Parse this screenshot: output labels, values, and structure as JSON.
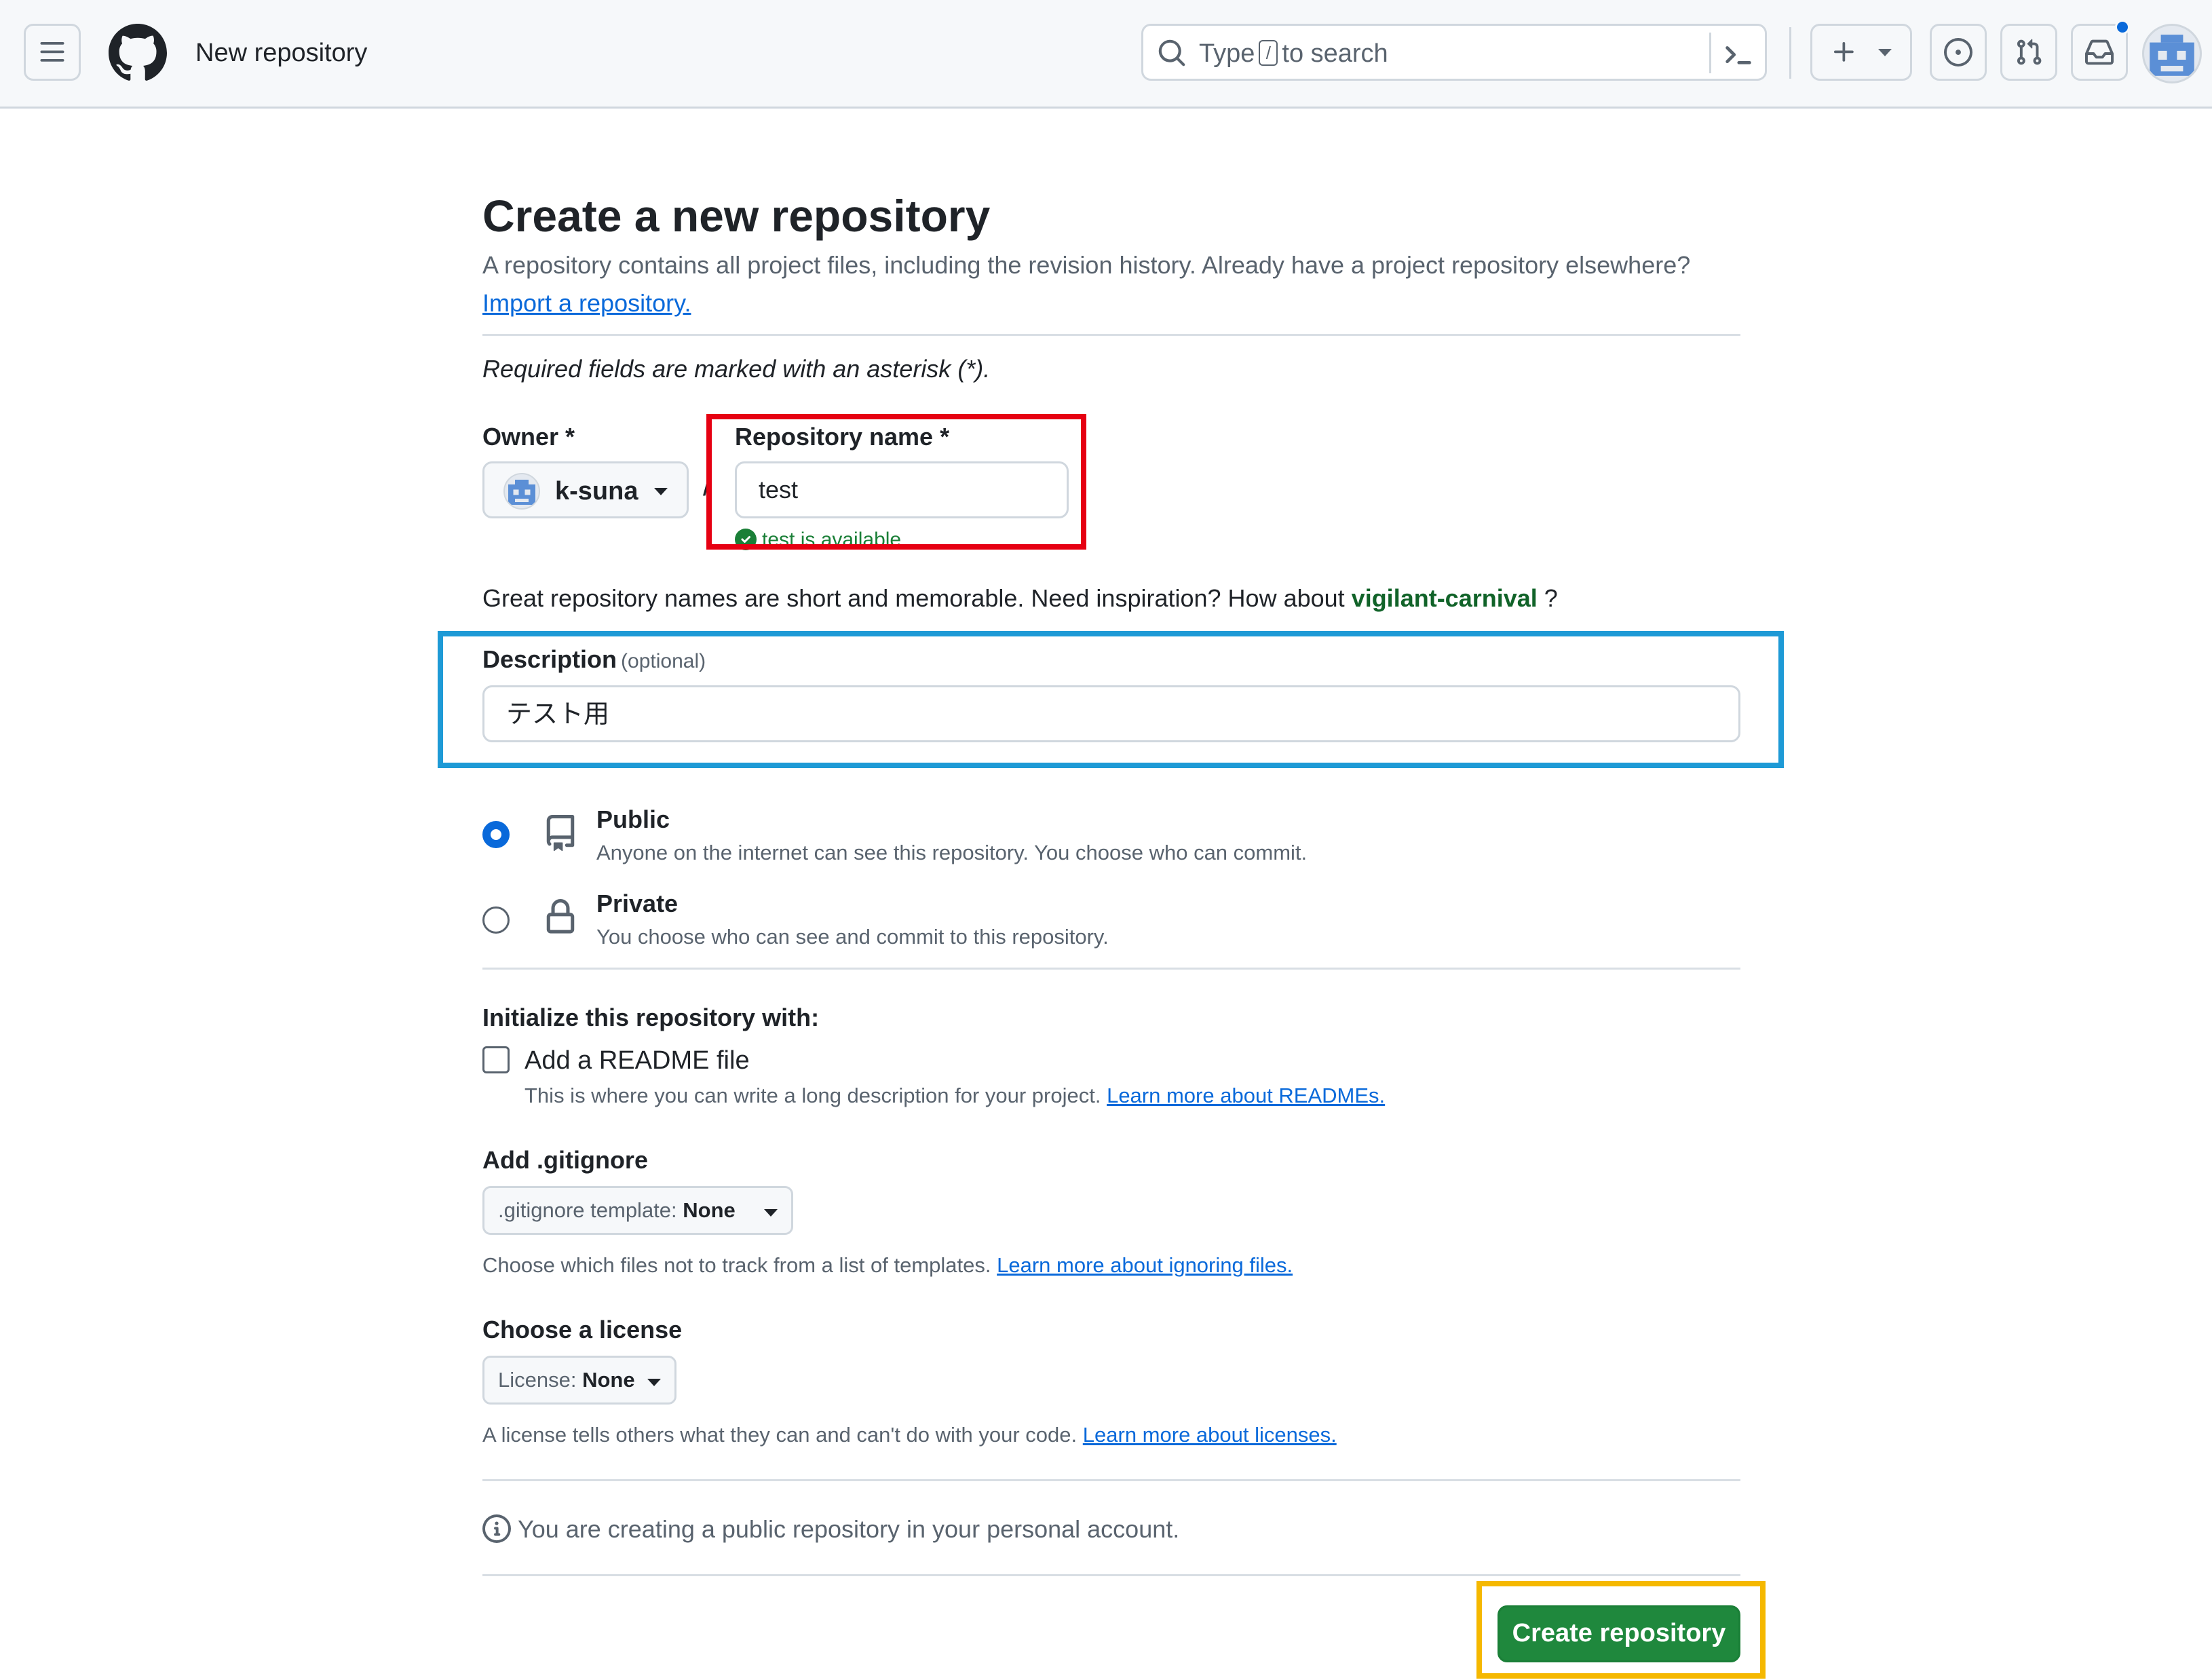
{
  "header": {
    "page_name": "New repository",
    "search": {
      "prefix": "Type",
      "key": "/",
      "suffix": "to search"
    },
    "icons": [
      "hamburger-icon",
      "github-logo",
      "search-icon",
      "command-palette-icon",
      "plus-icon",
      "issues-icon",
      "pull-request-icon",
      "inbox-icon"
    ],
    "notification_dot_color": "#0969da"
  },
  "form": {
    "title": "Create a new repository",
    "lead": "A repository contains all project files, including the revision history. Already have a project repository elsewhere?",
    "import_link": "Import a repository.",
    "required_note": "Required fields are marked with an asterisk (*).",
    "owner": {
      "label": "Owner *",
      "value": "k-suna"
    },
    "slash": "/",
    "repo_name": {
      "label": "Repository name *",
      "value": "test",
      "availability": "test is available"
    },
    "inspiration": {
      "prefix": "Great repository names are short and memorable. Need inspiration? How about",
      "suggestion": "vigilant-carnival",
      "suffix": "?"
    },
    "description": {
      "label": "Description",
      "optional": "(optional)",
      "value": "テスト用"
    },
    "visibility": [
      {
        "title": "Public",
        "desc": "Anyone on the internet can see this repository. You choose who can commit.",
        "selected": true,
        "icon": "repo-icon"
      },
      {
        "title": "Private",
        "desc": "You choose who can see and commit to this repository.",
        "selected": false,
        "icon": "lock-icon"
      }
    ],
    "init_heading": "Initialize this repository with:",
    "readme": {
      "label": "Add a README file",
      "checked": false,
      "help": "This is where you can write a long description for your project.",
      "link": "Learn more about READMEs."
    },
    "gitignore": {
      "heading": "Add .gitignore",
      "prefix": ".gitignore template:",
      "value": "None",
      "help": "Choose which files not to track from a list of templates.",
      "link": "Learn more about ignoring files."
    },
    "license": {
      "heading": "Choose a license",
      "prefix": "License:",
      "value": "None",
      "help": "A license tells others what they can and can't do with your code.",
      "link": "Learn more about licenses."
    },
    "info": "You are creating a public repository in your personal account.",
    "submit": "Create repository"
  },
  "annotations": {
    "repo_name_box_color": "#e60012",
    "description_box_color": "#1e9ad6",
    "create_button_box_color": "#f5b800"
  }
}
